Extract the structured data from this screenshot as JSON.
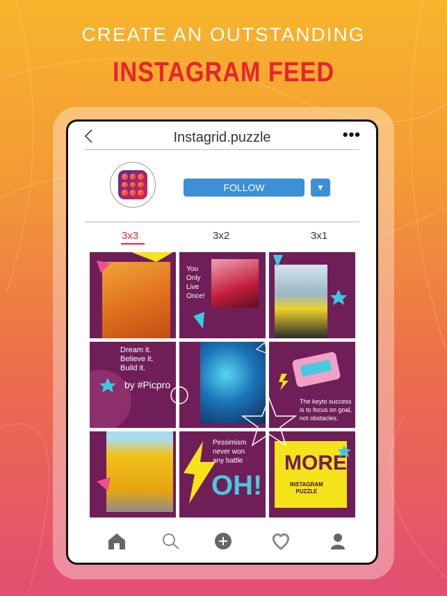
{
  "header": {
    "line1": "CREATE AN OUTSTANDING",
    "line2": "INSTAGRAM FEED"
  },
  "profile": {
    "title": "Instagrid.puzzle",
    "back_icon": "chevron-left-icon",
    "more_label": "•••",
    "follow_label": "FOLLOW",
    "dropdown_icon": "caret-down-icon"
  },
  "tabs": [
    {
      "label": "3x3",
      "active": true
    },
    {
      "label": "3x2",
      "active": false
    },
    {
      "label": "3x1",
      "active": false
    }
  ],
  "grid_text": {
    "yolo": "You\nOnly\nLive\nOnce!",
    "dream": "Dream it.\nBelieve it.\nBuild it.",
    "by": "by #Picpro",
    "key": "The keyto success\nis to focus on goal,\nnot obstacles.",
    "pessimism": "Pessimism\nnever won\nany battle",
    "oh": "OH!",
    "more": "MORE",
    "more_sub": "INSTAGRAM\nPUZZLE"
  },
  "nav": [
    "home-icon",
    "search-icon",
    "add-icon",
    "heart-icon",
    "profile-icon"
  ],
  "colors": {
    "accent": "#e8232f",
    "button": "#3d8fd8",
    "grid_bg": "#6f1e57",
    "yellow": "#f5e31a"
  }
}
